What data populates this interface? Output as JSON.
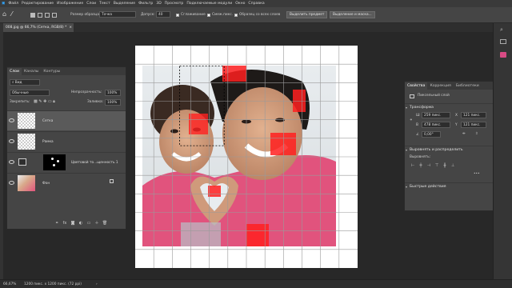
{
  "menu": [
    "Файл",
    "Редактирование",
    "Изображение",
    "Слои",
    "Текст",
    "Выделение",
    "Фильтр",
    "3D",
    "Просмотр",
    "Подключаемые модули",
    "Окно",
    "Справка"
  ],
  "options": {
    "sample_size_label": "Размер образца:",
    "sample_size_value": "Точка",
    "tolerance_label": "Допуск:",
    "tolerance_value": "40",
    "anti_alias": "Сглаживание",
    "contiguous": "Смеж.пикс.",
    "sample_all": "Образец со всех слоев",
    "select_subject": "Выделить предмет",
    "select_mask": "Выделение и маска..."
  },
  "doc_tab": {
    "title": "008.jpg @ 66,7% (Сетка, RGB/8) *",
    "close": "×"
  },
  "layers_panel": {
    "tabs": [
      "Слои",
      "Каналы",
      "Контуры"
    ],
    "filter_label": "Вид",
    "blend_mode": "Обычные",
    "opacity_label": "Непрозрачность:",
    "opacity_value": "100%",
    "lock_label": "Закрепить:",
    "fill_label": "Заливка:",
    "fill_value": "100%",
    "layers": [
      {
        "name": "Сетка",
        "selected": true,
        "type": "transparent"
      },
      {
        "name": "Рамка",
        "selected": false,
        "type": "transparent"
      },
      {
        "name": "Цветовой то...щенность 1",
        "selected": false,
        "type": "adjustment"
      },
      {
        "name": "Фон",
        "selected": false,
        "type": "photo",
        "locked": true
      }
    ],
    "footer_icons": [
      "link-icon",
      "fx-icon",
      "mask-icon",
      "adjustment-icon",
      "group-icon",
      "new-layer-icon",
      "trash-icon"
    ]
  },
  "properties_panel": {
    "tabs": [
      "Свойства",
      "Коррекция",
      "Библиотеки"
    ],
    "layer_type": "Пиксельный слой",
    "transform_title": "Трансформа",
    "w_label": "Ш",
    "w_value": "259 пикс.",
    "h_label": "В",
    "h_value": "478 пикс.",
    "x_label": "X",
    "x_value": "121 пикс.",
    "y_label": "Y",
    "y_value": "121 пикс.",
    "angle_value": "0,00°",
    "align_title": "Выровнять и распределить",
    "align_label": "Выровнять:",
    "more": "•••",
    "quick_actions": "Быстрые действия"
  },
  "status": {
    "zoom": "66,67%",
    "doc_size": "1200 пикс. x 1200 пикс. (72 ppi)"
  },
  "colors": {
    "accent": "#5a9ff5",
    "red_overlay": "#ff2020",
    "bg": "#262626"
  }
}
